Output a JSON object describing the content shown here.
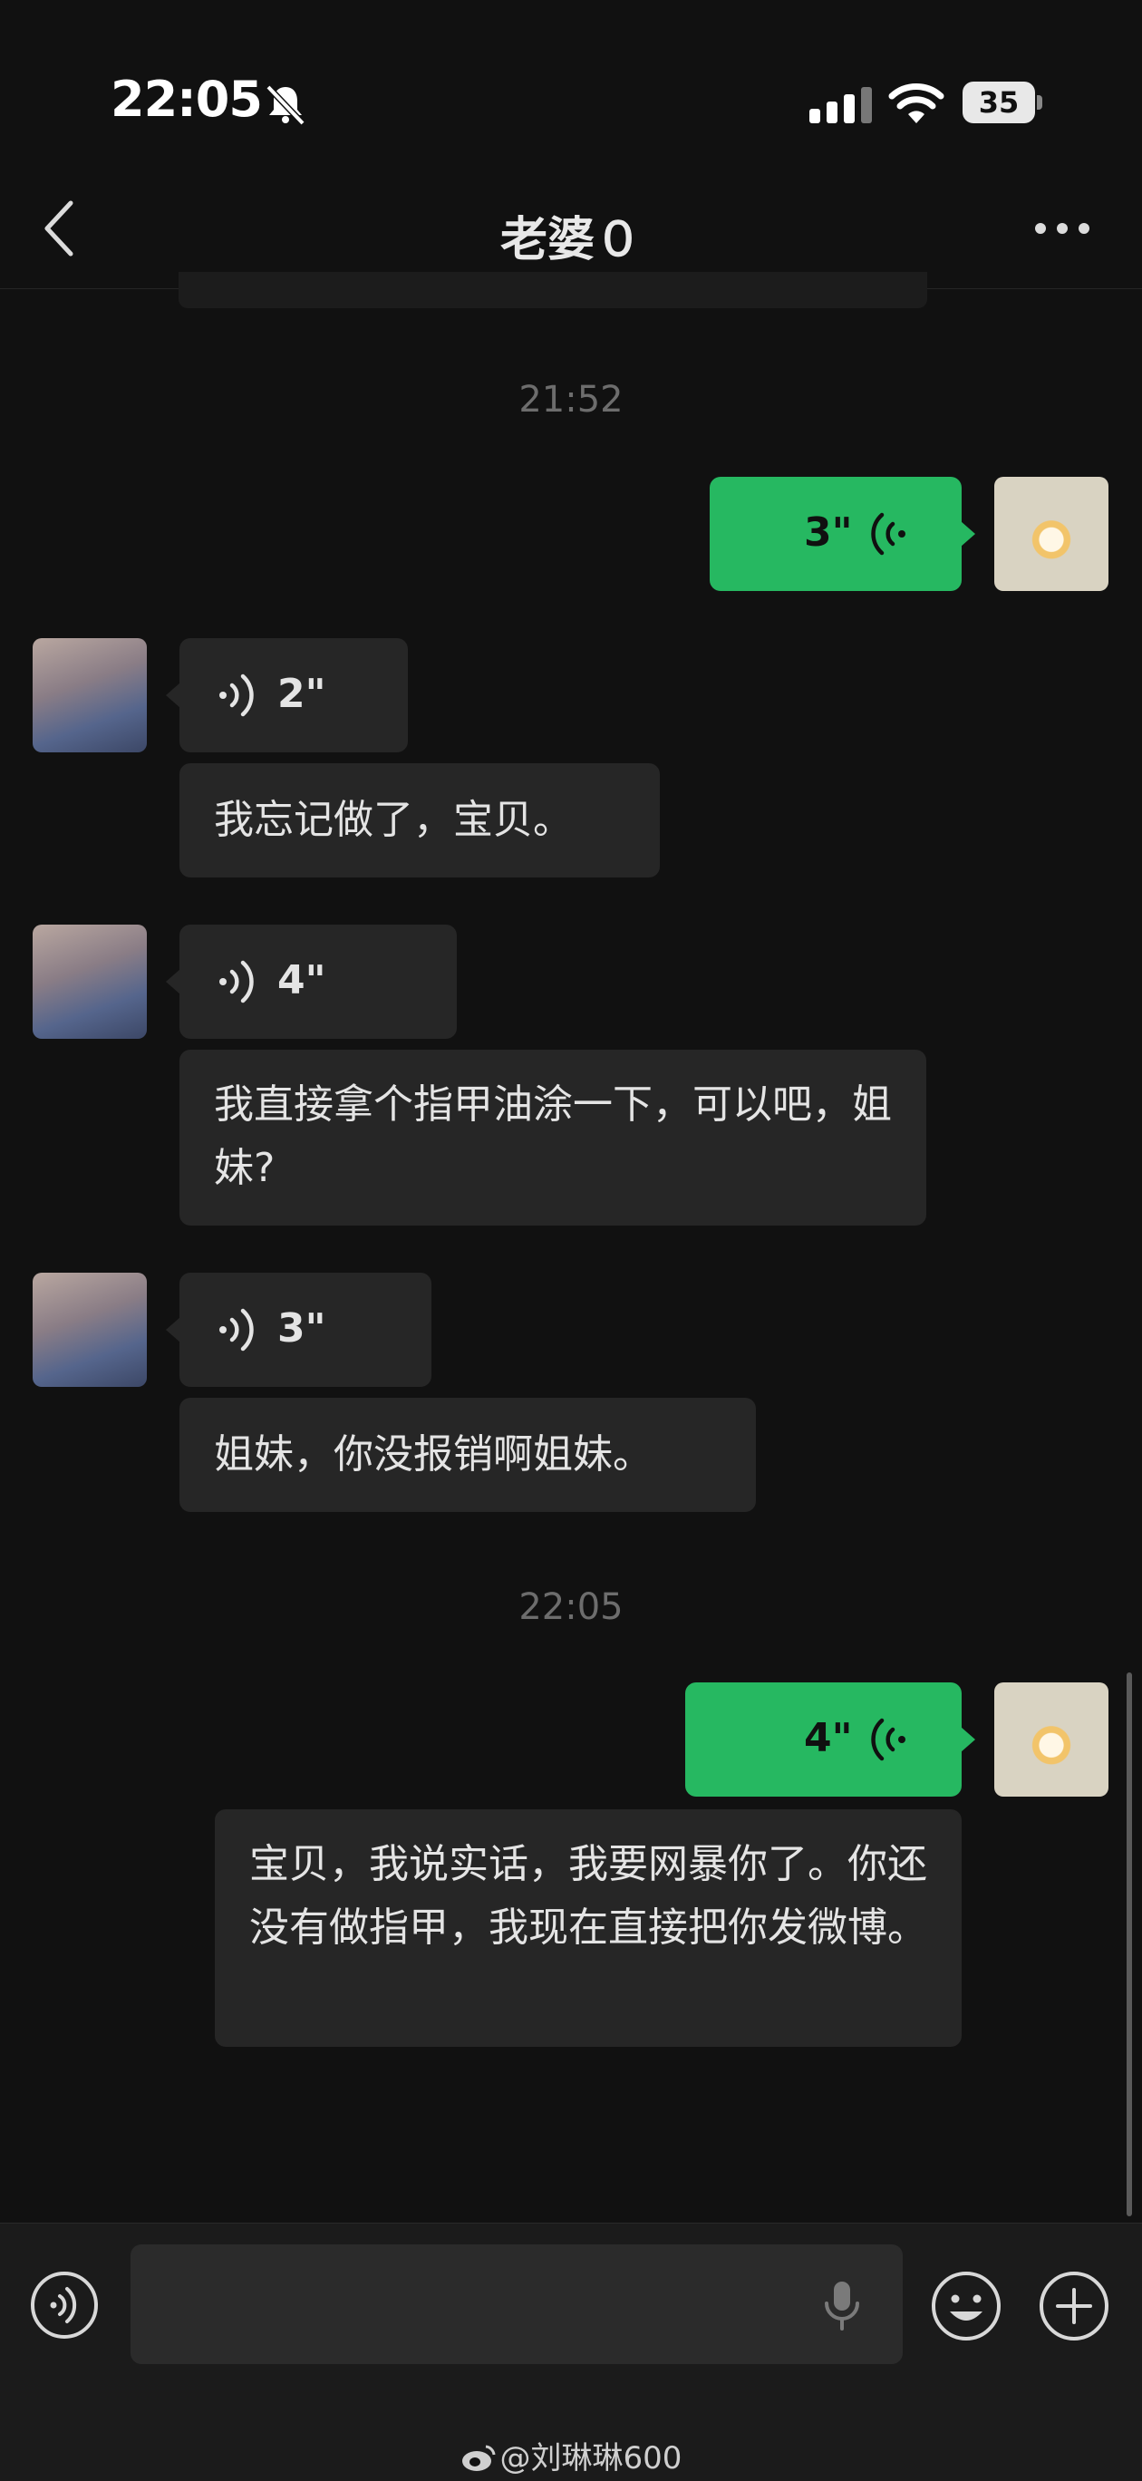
{
  "status_bar": {
    "time": "22:05",
    "battery": "35"
  },
  "header": {
    "title": "老婆０"
  },
  "timestamps": [
    "21:52",
    "22:05"
  ],
  "messages": [
    {
      "from": "self",
      "type": "voice",
      "duration": "3\""
    },
    {
      "from": "other",
      "type": "voice",
      "duration": "2\""
    },
    {
      "from": "other",
      "type": "text",
      "text": "我忘记做了，宝贝。"
    },
    {
      "from": "other",
      "type": "voice",
      "duration": "4\""
    },
    {
      "from": "other",
      "type": "text",
      "text": "我直接拿个指甲油涂一下，可以吧，姐妹?"
    },
    {
      "from": "other",
      "type": "voice",
      "duration": "3\""
    },
    {
      "from": "other",
      "type": "text",
      "text": "姐妹，你没报销啊姐妹。"
    },
    {
      "from": "self",
      "type": "voice",
      "duration": "4\""
    },
    {
      "from": "self",
      "type": "text",
      "text": "宝贝，我说实话，我要网暴你了。你还没有做指甲，我现在直接把你发微博。"
    }
  ],
  "watermark": "@刘琳琳600",
  "colors": {
    "self_bubble": "#26b861",
    "other_bubble": "#262626",
    "background": "#111111"
  },
  "icons": [
    "bell-slash-icon",
    "signal-icon",
    "wifi-icon",
    "back-icon",
    "more-icon",
    "voice-mode-icon",
    "mic-icon",
    "emoji-icon",
    "plus-icon",
    "weibo-icon"
  ]
}
